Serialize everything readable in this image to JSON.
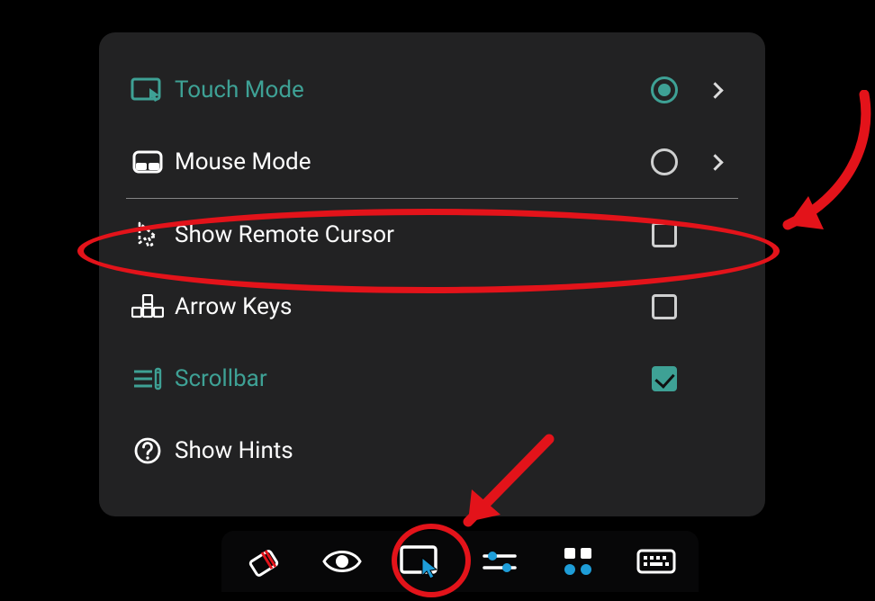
{
  "accent": "#3ea195",
  "panel": {
    "items": [
      {
        "id": "touch-mode",
        "label": "Touch Mode",
        "icon": "touch-screen-icon",
        "selected": true,
        "hasChevron": true,
        "accent": true
      },
      {
        "id": "mouse-mode",
        "label": "Mouse Mode",
        "icon": "mouse-icon",
        "selected": false,
        "hasChevron": true,
        "accent": false
      }
    ],
    "options": [
      {
        "id": "show-remote-cursor",
        "label": "Show Remote Cursor",
        "icon": "cursor-outline-icon",
        "checked": false,
        "accent": false
      },
      {
        "id": "arrow-keys",
        "label": "Arrow Keys",
        "icon": "arrow-keys-icon",
        "checked": false,
        "accent": false
      },
      {
        "id": "scrollbar",
        "label": "Scrollbar",
        "icon": "scrollbar-icon",
        "checked": true,
        "accent": true
      },
      {
        "id": "show-hints",
        "label": "Show Hints",
        "icon": "help-icon",
        "checked": null,
        "accent": false
      }
    ]
  },
  "toolbar": {
    "items": [
      {
        "id": "eraser",
        "icon": "eraser-icon"
      },
      {
        "id": "view",
        "icon": "eye-icon"
      },
      {
        "id": "pointer",
        "icon": "pointer-screen-icon",
        "highlighted": true
      },
      {
        "id": "settings",
        "icon": "sliders-icon"
      },
      {
        "id": "grid",
        "icon": "grid-icon"
      },
      {
        "id": "keyboard",
        "icon": "keyboard-icon"
      }
    ]
  },
  "annotations": {
    "circled_row": "show-remote-cursor",
    "circled_toolbar_item": "pointer",
    "arrows": [
      "to-row-right",
      "to-toolbar-item"
    ]
  }
}
